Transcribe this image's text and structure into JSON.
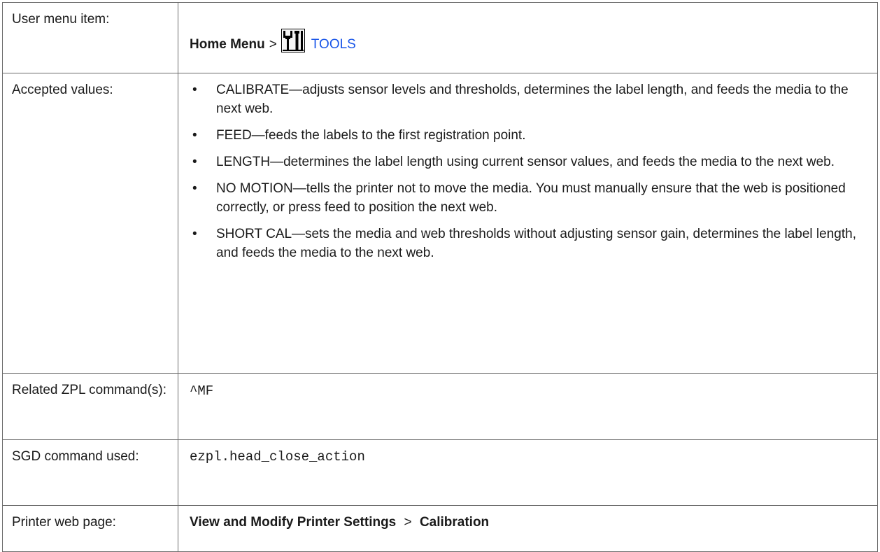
{
  "rows": {
    "menu": {
      "label": "User menu item:",
      "path_root": "Home Menu",
      "separator": ">",
      "icon": "tools-icon",
      "link_text": "TOOLS",
      "link_color": "#1a56e8"
    },
    "values": {
      "label": "Accepted values:",
      "items": [
        "CALIBRATE—adjusts sensor levels and thresholds, determines the label length, and feeds the media to the next web.",
        "FEED—feeds the labels to the first registration point.",
        "LENGTH—determines the label length using current sensor values, and feeds the media to the next web.",
        "NO MOTION—tells the printer not to move the media. You must manually ensure that the web is positioned correctly, or press feed to position the next web.",
        "SHORT CAL—sets the media and web thresholds without adjusting sensor gain, determines the label length, and feeds the media to the next web."
      ],
      "bullet": "•"
    },
    "zpl": {
      "label": "Related ZPL command(s):",
      "value": "^MF"
    },
    "sgd": {
      "label": "SGD command used:",
      "value": "ezpl.head_close_action"
    },
    "web": {
      "label": "Printer web page:",
      "path_root": "View and Modify Printer Settings",
      "separator": ">",
      "path_leaf": "Calibration"
    }
  }
}
